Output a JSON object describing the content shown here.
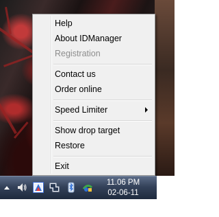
{
  "context_menu": {
    "items": [
      {
        "label": "Help",
        "enabled": true
      },
      {
        "label": "About IDManager",
        "enabled": true
      },
      {
        "label": "Registration",
        "enabled": false
      },
      {
        "label": "Contact us",
        "enabled": true
      },
      {
        "label": "Order online",
        "enabled": true
      },
      {
        "label": "Speed Limiter",
        "enabled": true,
        "submenu": true
      },
      {
        "label": "Show drop target",
        "enabled": true
      },
      {
        "label": "Restore",
        "enabled": true
      },
      {
        "label": "Exit",
        "enabled": true
      }
    ]
  },
  "taskbar": {
    "tray_icons": [
      "show-hidden-icons-arrow",
      "volume-icon",
      "idm-icon",
      "network-icon",
      "bluetooth-icon",
      "action-center-icon"
    ],
    "clock": {
      "time": "11.06 PM",
      "date": "02-06-11"
    }
  },
  "colors": {
    "menu_background": "#f0f0f0",
    "menu_disabled_text": "#8d8d8d",
    "taskbar": "#2a374d"
  }
}
